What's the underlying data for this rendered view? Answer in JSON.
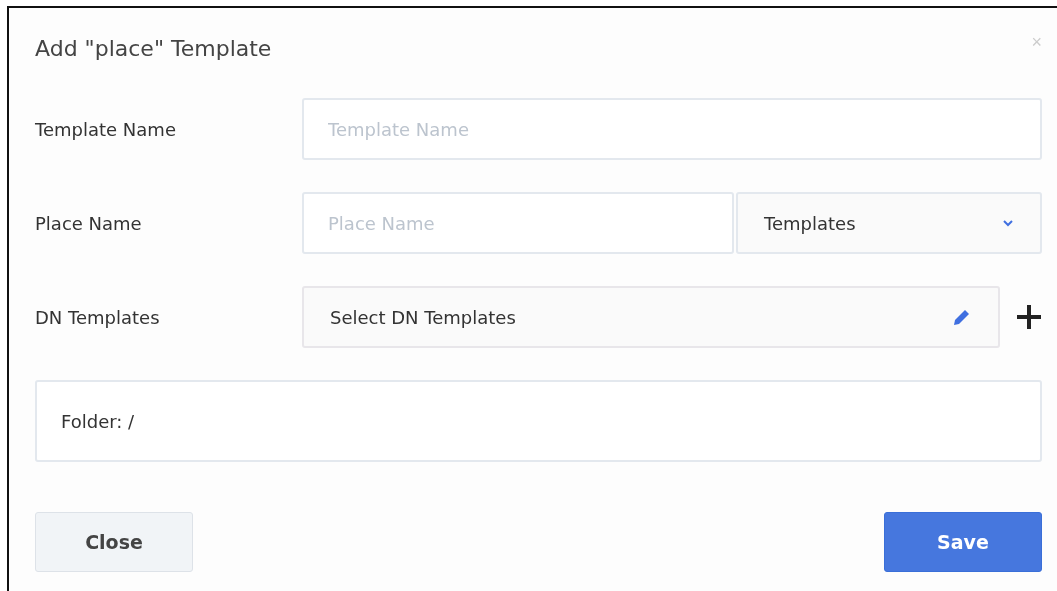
{
  "dialog": {
    "title": "Add \"place\" Template",
    "close_glyph": "×"
  },
  "fields": [
    {
      "kind": "text",
      "label": "Template Name",
      "placeholder": "Template Name"
    },
    {
      "kind": "text-select",
      "label": "Place Name",
      "placeholder": "Place Name",
      "select_value": "Templates"
    },
    {
      "kind": "picker",
      "label": "DN Templates",
      "value": "Select DN Templates"
    }
  ],
  "folder": "Folder: /",
  "buttons": {
    "close": "Close",
    "save": "Save"
  }
}
